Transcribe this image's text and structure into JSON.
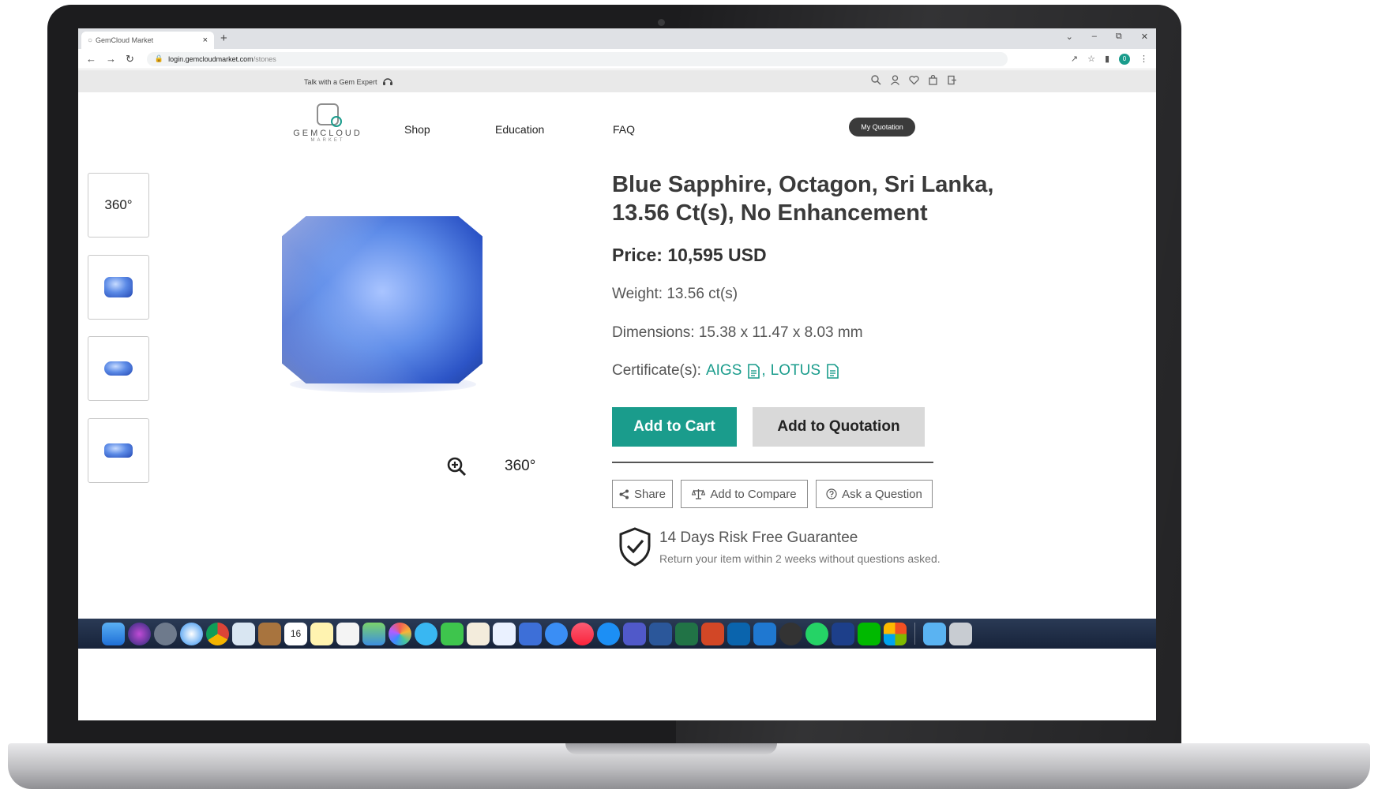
{
  "browser": {
    "tab_title": "GemCloud Market",
    "tab_close": "×",
    "new_tab": "+",
    "url_host": "login.gemcloudmarket.com",
    "url_path": "/stones",
    "profile_initial": "0"
  },
  "topbar": {
    "expert_label": "Talk with a Gem Expert"
  },
  "site": {
    "logo_text": "GEMCLOUD",
    "logo_sub": "MARKET",
    "nav": {
      "shop": "Shop",
      "education": "Education",
      "faq": "FAQ"
    },
    "my_quotation": "My Quotation"
  },
  "gallery": {
    "thumb_360_label": "360°",
    "main_360_label": "360°"
  },
  "product": {
    "title": "Blue Sapphire, Octagon, Sri Lanka, 13.56 Ct(s), No Enhancement",
    "price": "Price: 10,595 USD",
    "weight": "Weight: 13.56 ct(s)",
    "dimensions": "Dimensions: 15.38 x 11.47 x 8.03 mm",
    "certificates_label": "Certificate(s):",
    "certificates": [
      "AIGS",
      "LOTUS"
    ],
    "cert_separator": ","
  },
  "actions": {
    "add_to_cart": "Add to Cart",
    "add_to_quotation": "Add to Quotation",
    "share": "Share",
    "add_to_compare": "Add to Compare",
    "ask_question": "Ask a Question"
  },
  "guarantee": {
    "title": "14 Days Risk Free Guarantee",
    "subtitle": "Return your item within 2 weeks without questions asked."
  },
  "dock": {
    "calendar_day": "16"
  },
  "colors": {
    "accent": "#1a9c8c",
    "quotation_button": "#d9d9d9",
    "my_quotation_button": "#3b3b3b",
    "gem_blue": "#4a78e0"
  }
}
